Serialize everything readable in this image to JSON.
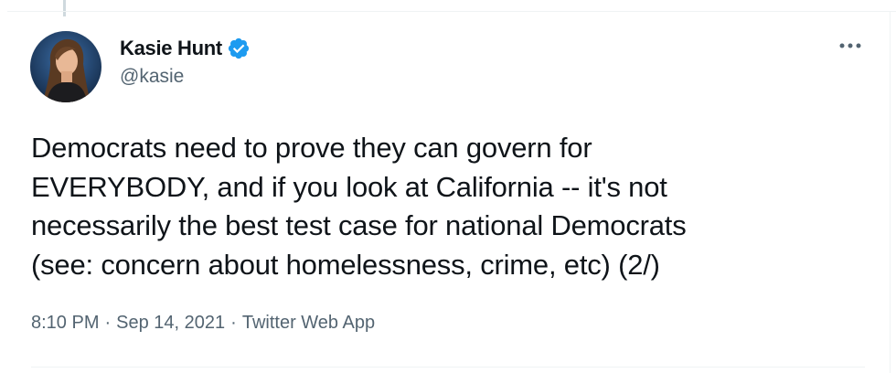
{
  "tweet": {
    "author": {
      "display_name": "Kasie Hunt",
      "handle": "@kasie",
      "verified": true,
      "avatar_icon": "profile-photo"
    },
    "more_icon": "more-horizontal-icon",
    "text_lines": [
      "Democrats need to prove they can govern for",
      "EVERYBODY, and if you look at California -- it's not",
      "necessarily the best test case for national Democrats",
      "(see: concern about homelessness, crime, etc) (2/)"
    ],
    "time": "8:10 PM",
    "separator": "·",
    "date": "Sep 14, 2021",
    "source": "Twitter Web App"
  },
  "colors": {
    "text_primary": "#0f1419",
    "text_secondary": "#536471",
    "verified_blue": "#1d9bf0",
    "border": "#eff3f4"
  }
}
